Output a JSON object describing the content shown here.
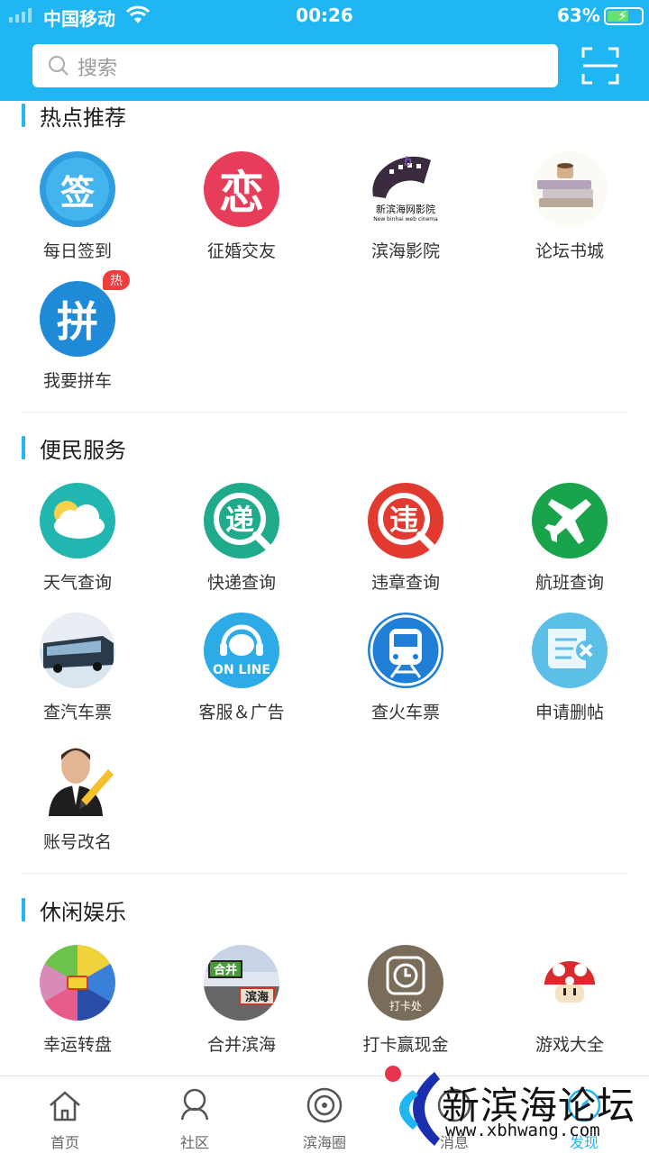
{
  "status_bar": {
    "carrier": "中国移动",
    "time": "00:26",
    "battery": "63%",
    "battery_level": 0.63
  },
  "search": {
    "placeholder": "搜索"
  },
  "sections": [
    {
      "title": "热点推荐",
      "items": [
        {
          "label": "每日签到",
          "icon": "sign-in-icon",
          "glyph": "签"
        },
        {
          "label": "征婚交友",
          "icon": "dating-icon",
          "glyph": "恋"
        },
        {
          "label": "滨海影院",
          "icon": "cinema-icon",
          "glyph": "新滨海网影院",
          "subtext": "New binhai web cinema"
        },
        {
          "label": "论坛书城",
          "icon": "books-icon"
        },
        {
          "label": "我要拼车",
          "icon": "carpool-icon",
          "glyph": "拼",
          "badge": "热"
        }
      ]
    },
    {
      "title": "便民服务",
      "items": [
        {
          "label": "天气查询",
          "icon": "weather-icon"
        },
        {
          "label": "快递查询",
          "icon": "express-icon",
          "glyph": "递"
        },
        {
          "label": "违章查询",
          "icon": "violation-icon",
          "glyph": "违"
        },
        {
          "label": "航班查询",
          "icon": "flight-icon"
        },
        {
          "label": "查汽车票",
          "icon": "bus-icon"
        },
        {
          "label": "客服＆广告",
          "icon": "customer-service-icon",
          "glyph": "ON LINE"
        },
        {
          "label": "查火车票",
          "icon": "train-icon"
        },
        {
          "label": "申请删帖",
          "icon": "delete-post-icon"
        },
        {
          "label": "账号改名",
          "icon": "rename-account-icon"
        }
      ]
    },
    {
      "title": "休闲娱乐",
      "items": [
        {
          "label": "幸运转盘",
          "icon": "lucky-wheel-icon"
        },
        {
          "label": "合并滨海",
          "icon": "merge-game-icon",
          "glyph": "合并",
          "glyph2": "滨海"
        },
        {
          "label": "打卡赢现金",
          "icon": "clock-in-icon",
          "glyph": "打卡处"
        },
        {
          "label": "游戏大全",
          "icon": "mushroom-icon"
        }
      ]
    }
  ],
  "tabbar": [
    {
      "label": "首页",
      "icon": "home-icon"
    },
    {
      "label": "社区",
      "icon": "community-icon"
    },
    {
      "label": "滨海圈",
      "icon": "circle-icon"
    },
    {
      "label": "消息",
      "icon": "message-icon"
    },
    {
      "label": "发现",
      "icon": "discover-icon",
      "active": true
    }
  ],
  "watermark": {
    "title": "新滨海论坛",
    "url": "www.xbhwang.com"
  },
  "colors": {
    "accent": "#1fb6f3",
    "badge": "#f23d3d"
  }
}
